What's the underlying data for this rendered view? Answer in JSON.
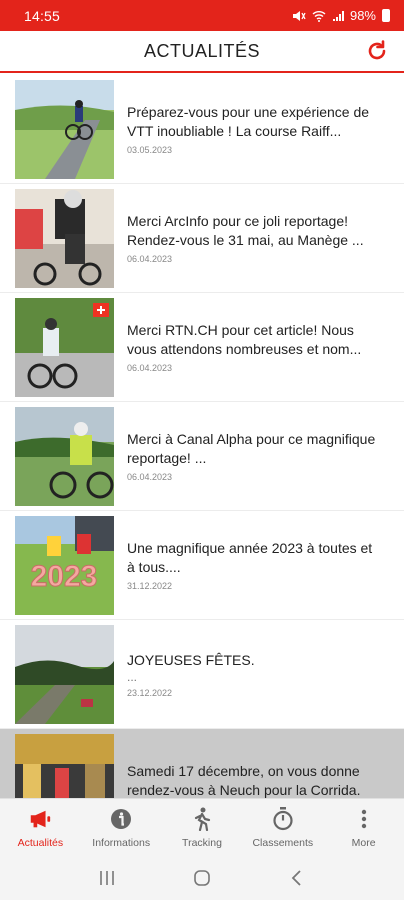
{
  "status": {
    "time": "14:55",
    "battery": "98%"
  },
  "header": {
    "title": "ACTUALITÉS"
  },
  "articles": [
    {
      "title": "Préparez-vous pour une expérience de VTT inoubliable ! La course Raiff...",
      "excerpt": "",
      "date": "03.05.2023"
    },
    {
      "title": "Merci ArcInfo pour ce joli reportage! Rendez-vous le 31 mai, au Manège ...",
      "excerpt": "",
      "date": "06.04.2023"
    },
    {
      "title": "Merci RTN.CH pour cet article! Nous vous attendons nombreuses et nom...",
      "excerpt": "",
      "date": "06.04.2023"
    },
    {
      "title": "Merci à Canal Alpha pour ce magnifique reportage! ...",
      "excerpt": "",
      "date": "06.04.2023"
    },
    {
      "title": "Une magnifique année 2023 à toutes et à tous....",
      "excerpt": "",
      "date": "31.12.2022"
    },
    {
      "title": "JOYEUSES FÊTES.",
      "excerpt": "...",
      "date": "23.12.2022"
    },
    {
      "title": "Samedi 17 décembre, on vous donne rendez-vous à Neuch pour la Corrida.",
      "excerpt": "",
      "date": ""
    }
  ],
  "thumb_text": {
    "year": "2023"
  },
  "tabs": [
    {
      "label": "Actualités",
      "icon": "megaphone-icon",
      "active": true
    },
    {
      "label": "Informations",
      "icon": "info-icon",
      "active": false
    },
    {
      "label": "Tracking",
      "icon": "walking-person-icon",
      "active": false
    },
    {
      "label": "Classements",
      "icon": "stopwatch-icon",
      "active": false
    },
    {
      "label": "More",
      "icon": "more-vertical-icon",
      "active": false
    }
  ],
  "colors": {
    "accent": "#e3241b",
    "inactive": "#666666"
  }
}
